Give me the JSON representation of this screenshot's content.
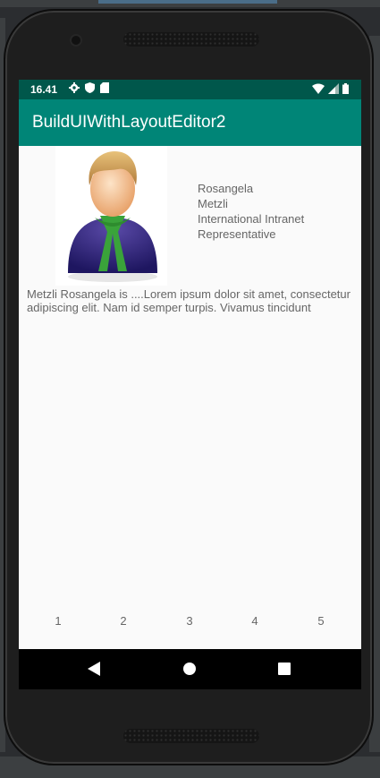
{
  "status_bar": {
    "time": "16.41",
    "left_icons": [
      "gear-icon",
      "shield-icon",
      "sd-card-icon"
    ],
    "right_icons": [
      "wifi-icon",
      "signal-icon",
      "battery-icon"
    ]
  },
  "app_bar": {
    "title": "BuildUIWithLayoutEditor2"
  },
  "profile": {
    "avatar_icon": "user-avatar-icon",
    "first_name": "Rosangela",
    "last_name": "Metzli",
    "title_line1": "International Intranet",
    "title_line2": "Representative",
    "bio": "Metzli Rosangela is ....Lorem ipsum dolor sit amet, consectetur adipiscing elit. Nam id semper turpis. Vivamus tincidunt"
  },
  "pager": {
    "items": [
      "1",
      "2",
      "3",
      "4",
      "5"
    ]
  },
  "nav_bar": {
    "icons": [
      "back-icon",
      "home-icon",
      "recents-icon"
    ]
  },
  "colors": {
    "status_bar": "#00574b",
    "app_bar": "#008577",
    "screen_bg": "#fafafa",
    "text": "#666666"
  }
}
